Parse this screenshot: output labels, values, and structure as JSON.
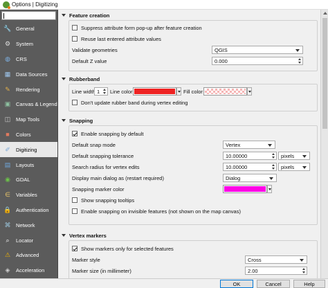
{
  "window": {
    "title": "Options | Digitizing"
  },
  "search": {
    "placeholder": ""
  },
  "sidebar": {
    "items": [
      {
        "label": "General",
        "icon": "wrench-icon"
      },
      {
        "label": "System",
        "icon": "gear-icon"
      },
      {
        "label": "CRS",
        "icon": "globe-icon"
      },
      {
        "label": "Data Sources",
        "icon": "table-icon"
      },
      {
        "label": "Rendering",
        "icon": "brush-icon"
      },
      {
        "label": "Canvas & Legend",
        "icon": "canvas-icon"
      },
      {
        "label": "Map Tools",
        "icon": "map-tools-icon"
      },
      {
        "label": "Colors",
        "icon": "colors-icon"
      },
      {
        "label": "Digitizing",
        "icon": "digitizing-icon",
        "active": true
      },
      {
        "label": "Layouts",
        "icon": "layouts-icon"
      },
      {
        "label": "GDAL",
        "icon": "gdal-icon"
      },
      {
        "label": "Variables",
        "icon": "variables-icon"
      },
      {
        "label": "Authentication",
        "icon": "lock-icon"
      },
      {
        "label": "Network",
        "icon": "network-icon"
      },
      {
        "label": "Locator",
        "icon": "search-icon"
      },
      {
        "label": "Advanced",
        "icon": "warning-icon"
      },
      {
        "label": "Acceleration",
        "icon": "acceleration-icon"
      }
    ]
  },
  "feature_creation": {
    "title": "Feature creation",
    "suppress_form": {
      "label": "Suppress attribute form pop-up after feature creation",
      "checked": false
    },
    "reuse_values": {
      "label": "Reuse last entered attribute values",
      "checked": false
    },
    "validate_geometries": {
      "label": "Validate geometries",
      "value": "QGIS"
    },
    "default_z": {
      "label": "Default Z value",
      "value": "0.000"
    }
  },
  "rubberband": {
    "title": "Rubberband",
    "line_width_label": "Line width",
    "line_width_value": "1",
    "line_color_label": "Line color",
    "line_color": "#ee2222",
    "fill_color_label": "Fill color",
    "fill_color": "#f5b5b5",
    "dont_update": {
      "label": "Don't update rubber band during vertex editing",
      "checked": false
    }
  },
  "snapping": {
    "title": "Snapping",
    "enable_default": {
      "label": "Enable snapping by default",
      "checked": true
    },
    "snap_mode": {
      "label": "Default snap mode",
      "value": "Vertex"
    },
    "tolerance": {
      "label": "Default snapping tolerance",
      "value": "10.00000",
      "unit": "pixels"
    },
    "search_radius": {
      "label": "Search radius for vertex edits",
      "value": "10.00000",
      "unit": "pixels"
    },
    "main_dialog": {
      "label": "Display main dialog as (restart required)",
      "value": "Dialog"
    },
    "marker_color": {
      "label": "Snapping marker color",
      "color": "#ff00e6"
    },
    "show_tooltips": {
      "label": "Show snapping tooltips",
      "checked": false
    },
    "invisible_features": {
      "label": "Enable snapping on invisible features (not shown on the map canvas)",
      "checked": false
    }
  },
  "vertex_markers": {
    "title": "Vertex markers",
    "only_selected": {
      "label": "Show markers only for selected features",
      "checked": true
    },
    "marker_style": {
      "label": "Marker style",
      "value": "Cross"
    },
    "marker_size": {
      "label": "Marker size (in millimeter)",
      "value": "2.00"
    }
  },
  "buttons": {
    "ok": "OK",
    "cancel": "Cancel",
    "help": "Help"
  }
}
